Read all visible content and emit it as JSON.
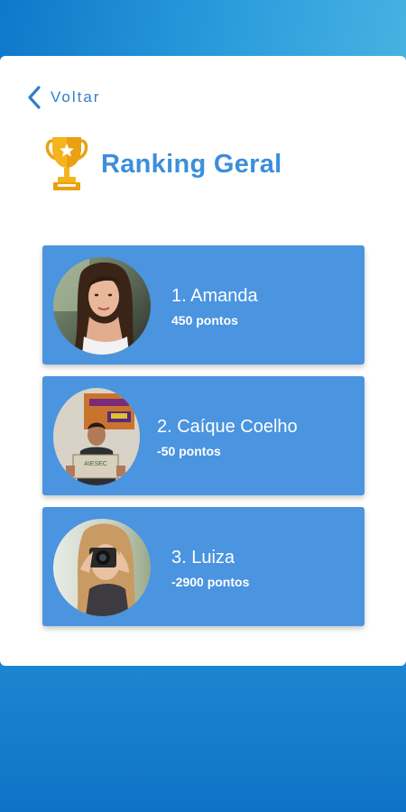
{
  "colors": {
    "accent": "#3b8fdb",
    "card_blue": "#4a94e0",
    "background_blue": "#1b82cf",
    "trophy_gold": "#f2b21b"
  },
  "nav": {
    "back_label": "Voltar",
    "back_icon": "chevron-left-icon"
  },
  "header": {
    "icon": "trophy-icon",
    "title": "Ranking Geral"
  },
  "ranking": [
    {
      "name": "1. Amanda",
      "points": "450 pontos",
      "avatar": "photo-woman-car"
    },
    {
      "name": "2. Caíque Coelho",
      "points": "-50 pontos",
      "avatar": "photo-man-sign"
    },
    {
      "name": "3. Luiza",
      "points": "-2900 pontos",
      "avatar": "photo-woman-camera"
    }
  ]
}
